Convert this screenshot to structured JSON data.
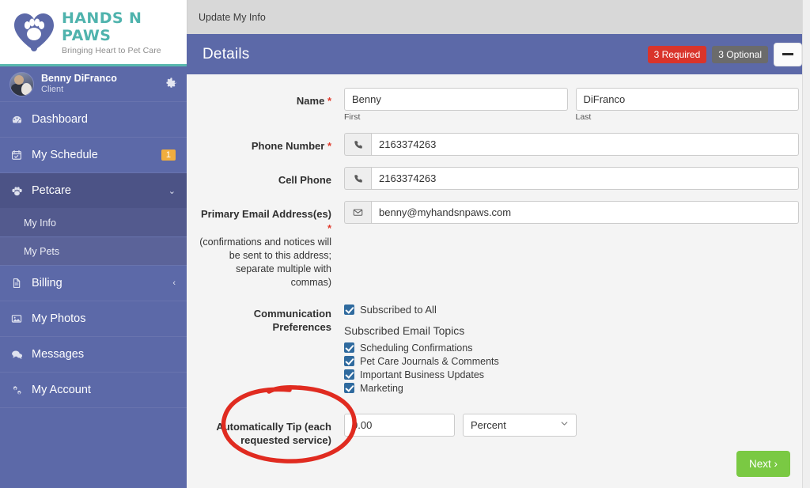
{
  "brand": {
    "title": "HANDS N PAWS",
    "tagline": "Bringing Heart to Pet Care",
    "logo_icon": "heart-paw-logo",
    "title_color": "#4fb3ad",
    "accent_color": "#5c69a8"
  },
  "user": {
    "name": "Benny DiFranco",
    "role": "Client",
    "avatar_icon": "user-avatar-photo",
    "settings_icon": "gear-icon"
  },
  "sidebar": {
    "items": [
      {
        "label": "Dashboard",
        "icon": "dashboard-icon",
        "glyph": "◔",
        "badge": "",
        "caret": "",
        "active": false
      },
      {
        "label": "My Schedule",
        "icon": "calendar-icon",
        "glyph": "Ὄ5",
        "badge": "1",
        "caret": "",
        "active": false
      },
      {
        "label": "Petcare",
        "icon": "paw-icon",
        "glyph": "✿",
        "badge": "",
        "caret": "⌄",
        "active": true
      },
      {
        "label": "Billing",
        "icon": "document-icon",
        "glyph": "Ὄ4",
        "badge": "",
        "caret": "‹",
        "active": false
      },
      {
        "label": "My Photos",
        "icon": "photo-icon",
        "glyph": "ὛC",
        "badge": "",
        "caret": "",
        "active": false
      },
      {
        "label": "Messages",
        "icon": "chat-icon",
        "glyph": "ὊC",
        "badge": "",
        "caret": "",
        "active": false
      },
      {
        "label": "My Account",
        "icon": "gears-icon",
        "glyph": "⚙",
        "badge": "",
        "caret": "",
        "active": false
      }
    ],
    "subitems": [
      {
        "label": "My Info",
        "active": true
      },
      {
        "label": "My Pets",
        "active": false
      }
    ],
    "badge_color": "#f0ad3e"
  },
  "topbar": {
    "breadcrumb": "Update My Info"
  },
  "panel": {
    "title": "Details",
    "badge_required": "3 Required",
    "badge_optional": "3 Optional",
    "badge_required_color": "#d9342b",
    "badge_optional_color": "#6b6b6b",
    "minimize_icon": "minimize-icon"
  },
  "form": {
    "name": {
      "label": "Name",
      "required_marker": "*",
      "first_value": "Benny",
      "first_sublabel": "First",
      "last_value": "DiFranco",
      "last_sublabel": "Last"
    },
    "phone": {
      "label": "Phone Number",
      "required_marker": "*",
      "value": "2163374263",
      "icon": "phone-icon",
      "glyph": "☎"
    },
    "cell": {
      "label": "Cell Phone",
      "value": "2163374263",
      "icon": "phone-icon",
      "glyph": "☎"
    },
    "email": {
      "label": "Primary Email Address(es)",
      "required_marker": "*",
      "hint": "(confirmations and notices will be sent to this address; separate multiple with commas)",
      "value": "benny@myhandsnpaws.com",
      "icon": "envelope-icon",
      "glyph": "✉"
    },
    "communication": {
      "label": "Communication Preferences",
      "subscribe_all_label": "Subscribed to All",
      "subscribe_all_checked": true,
      "topics_title": "Subscribed Email Topics",
      "topics": [
        {
          "label": "Scheduling Confirmations",
          "checked": true
        },
        {
          "label": "Pet Care Journals & Comments",
          "checked": true
        },
        {
          "label": "Important Business Updates",
          "checked": true
        },
        {
          "label": "Marketing",
          "checked": true
        }
      ]
    },
    "tip": {
      "label": "Automatically Tip (each requested service)",
      "amount_value": "0.00",
      "unit_value": "Percent",
      "unit_caret_icon": "chevron-down-icon"
    }
  },
  "footer": {
    "next_label": "Next ›",
    "next_color": "#7ac943"
  },
  "annotation": {
    "shape": "red-ellipse-highlight",
    "color": "#e02b20"
  }
}
